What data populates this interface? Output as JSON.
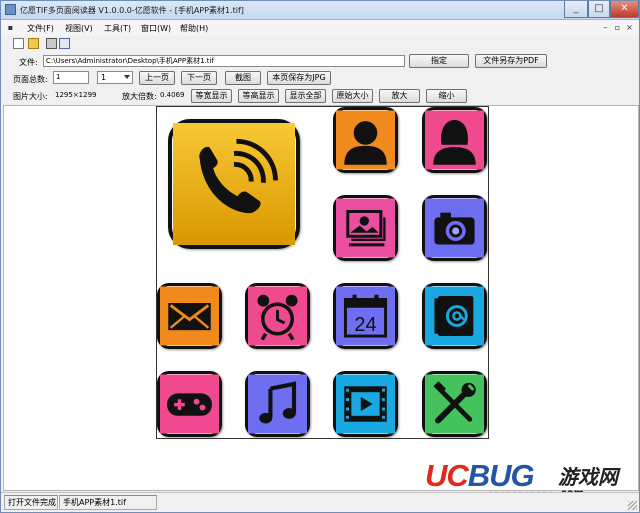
{
  "window": {
    "title": "亿愿TIF多页面阅读器 V1.0.0.0-亿愿软件 - [手机APP素材1.tif]"
  },
  "menu": {
    "items": [
      {
        "label": "文件(F)"
      },
      {
        "label": "视图(V)"
      },
      {
        "label": "工具(T)"
      },
      {
        "label": "窗口(W)"
      },
      {
        "label": "帮助(H)"
      }
    ]
  },
  "toolbar": {
    "icons": [
      "new-file-icon",
      "open-folder-icon",
      "print-icon",
      "print-preview-icon"
    ]
  },
  "file_row": {
    "label": "文件:",
    "path": "C:\\Users\\Administrator\\Desktop\\手机APP素材1.tif",
    "specify_button": "指定",
    "save_pdf_button": "文件另存为PDF"
  },
  "page_row": {
    "total_label": "页面总数:",
    "total_value": "1",
    "current_page": "1",
    "prev_button": "上一页",
    "next_button": "下一页",
    "screenshot_button": "截图",
    "save_jpg_button": "本页保存为JPG"
  },
  "size_row": {
    "size_label": "图片大小:",
    "size_value": "1295×1299",
    "zoom_label": "放大倍数:",
    "zoom_value": "0.4069",
    "fit_width_button": "等宽显示",
    "fit_height_button": "等高显示",
    "show_all_button": "显示全部",
    "original_size_button": "原始大小",
    "zoom_in_button": "放大",
    "zoom_out_button": "缩小"
  },
  "status": {
    "message": "打开文件完成",
    "filename": "手机APP素材1.tif"
  },
  "watermark": {
    "brand_uc": "UC",
    "brand_bug": "BUG",
    "brand_cn": "游戏网",
    "domain": ".com"
  },
  "app_icons": [
    {
      "name": "phone-app-icon",
      "color": "#f2b705"
    },
    {
      "name": "male-contact-app-icon",
      "color": "#f08a1c"
    },
    {
      "name": "female-contact-app-icon",
      "color": "#ef4a8f"
    },
    {
      "name": "gallery-app-icon",
      "color": "#ea4ea0"
    },
    {
      "name": "camera-app-icon",
      "color": "#6e6ef0"
    },
    {
      "name": "mail-app-icon",
      "color": "#f08a1c"
    },
    {
      "name": "alarm-clock-app-icon",
      "color": "#ef4a8f"
    },
    {
      "name": "calendar-app-icon",
      "color": "#6e6ef0"
    },
    {
      "name": "address-book-app-icon",
      "color": "#1aa8e2"
    },
    {
      "name": "game-controller-app-icon",
      "color": "#ef4a8f"
    },
    {
      "name": "music-app-icon",
      "color": "#6e6ef0"
    },
    {
      "name": "video-app-icon",
      "color": "#1aa8e2"
    },
    {
      "name": "tools-app-icon",
      "color": "#43c25e"
    }
  ],
  "calendar_day": "24"
}
